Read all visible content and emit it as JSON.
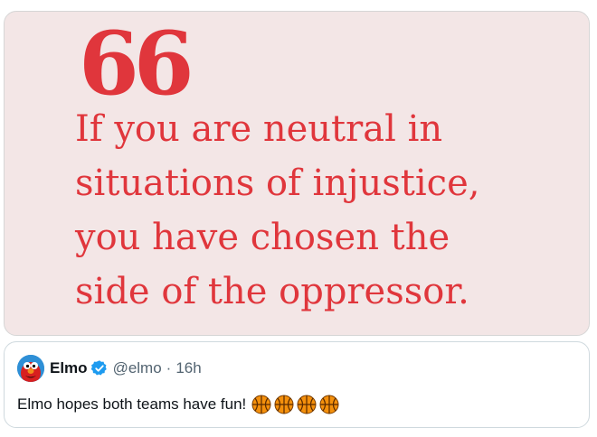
{
  "media": {
    "quote_mark": "66",
    "quote_text": "If you are neutral in\nsituations of injustice,\nyou have chosen the\nside of the oppressor.",
    "quote_color": "#e0363c",
    "background_color": "#f3e6e6"
  },
  "quoted_tweet": {
    "avatar_icon": "elmo-avatar",
    "display_name": "Elmo",
    "verified_icon": "verified-badge-icon",
    "handle": "@elmo",
    "separator": "·",
    "time": "16h",
    "text": "Elmo hopes both teams have fun!",
    "emojis": [
      "basketball-icon",
      "basketball-icon",
      "basketball-icon",
      "basketball-icon"
    ],
    "verified_color": "#1d9bf0"
  }
}
